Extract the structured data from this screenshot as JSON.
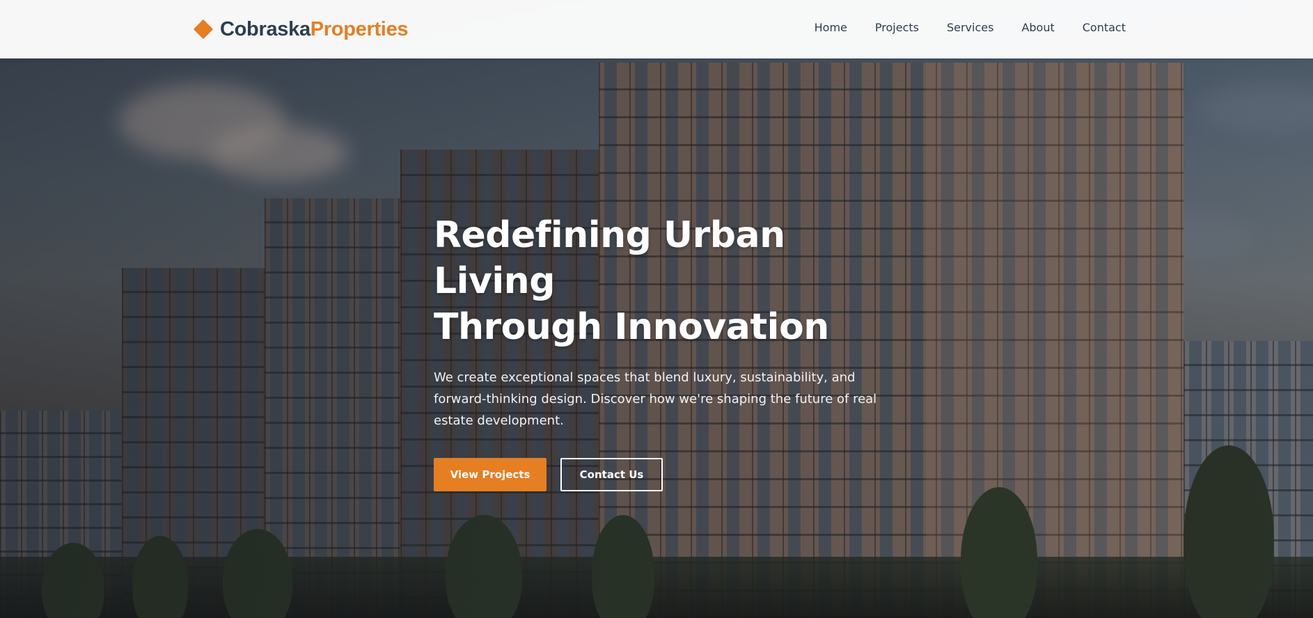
{
  "brand": {
    "name_primary": "Cobraska",
    "name_accent": "Properties",
    "icon": "diamond-icon",
    "accent_color": "#e67e22",
    "dark_color": "#2c3e50"
  },
  "nav": {
    "items": [
      {
        "label": "Home"
      },
      {
        "label": "Projects"
      },
      {
        "label": "Services"
      },
      {
        "label": "About"
      },
      {
        "label": "Contact"
      }
    ]
  },
  "hero": {
    "title_line1": "Redefining Urban Living",
    "title_line2": "Through Innovation",
    "subtitle": "We create exceptional spaces that blend luxury, sustainability, and forward-thinking design. Discover how we're shaping the future of real estate development.",
    "primary_button": "View Projects",
    "secondary_button": "Contact Us"
  }
}
